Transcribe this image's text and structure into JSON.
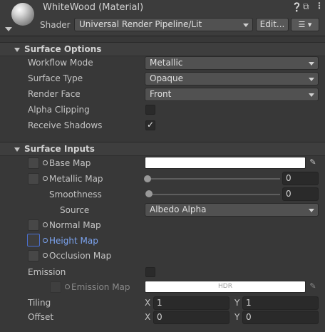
{
  "header": {
    "title": "WhiteWood (Material)",
    "shader_label": "Shader",
    "shader_value": "Universal Render Pipeline/Lit",
    "edit_button": "Edit..."
  },
  "surface_options": {
    "title": "Surface Options",
    "workflow_mode": {
      "label": "Workflow Mode",
      "value": "Metallic"
    },
    "surface_type": {
      "label": "Surface Type",
      "value": "Opaque"
    },
    "render_face": {
      "label": "Render Face",
      "value": "Front"
    },
    "alpha_clipping": {
      "label": "Alpha Clipping",
      "checked": false
    },
    "receive_shadows": {
      "label": "Receive Shadows",
      "checked": true
    }
  },
  "surface_inputs": {
    "title": "Surface Inputs",
    "base_map": {
      "label": "Base Map",
      "color": "#ffffff"
    },
    "metallic_map": {
      "label": "Metallic Map",
      "value": "0",
      "level": 0
    },
    "smoothness": {
      "label": "Smoothness",
      "value": "0",
      "level": 0
    },
    "source": {
      "label": "Source",
      "value": "Albedo Alpha"
    },
    "normal_map": {
      "label": "Normal Map"
    },
    "height_map": {
      "label": "Height Map"
    },
    "occlusion_map": {
      "label": "Occlusion Map"
    },
    "emission": {
      "label": "Emission",
      "checked": false
    },
    "emission_map": {
      "label": "Emission Map",
      "badge": "HDR",
      "color": "#ffffff"
    },
    "tiling": {
      "label": "Tiling",
      "x_label": "X",
      "x": "1",
      "y_label": "Y",
      "y": "1"
    },
    "offset": {
      "label": "Offset",
      "x_label": "X",
      "x": "0",
      "y_label": "Y",
      "y": "0"
    }
  },
  "colors": {
    "background": "#383838",
    "accent": "#4a6fd0",
    "highlight_text": "#7ca4f0"
  },
  "icons": [
    "material-sphere-icon",
    "help-icon",
    "settings-sliders-icon",
    "more-menu-icon",
    "list-menu-icon",
    "eyedropper-icon"
  ]
}
